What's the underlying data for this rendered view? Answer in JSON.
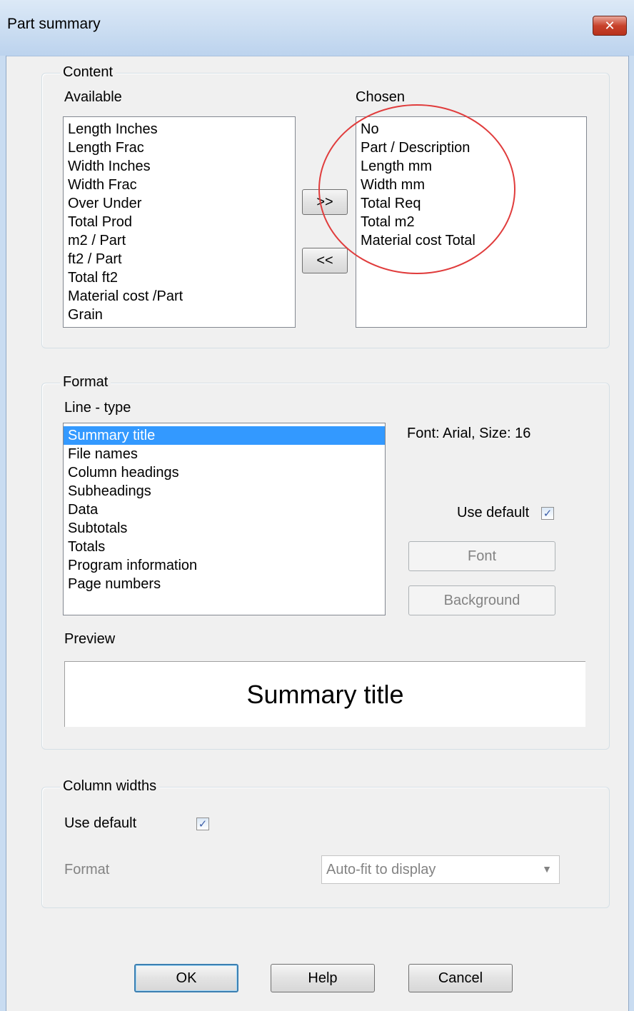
{
  "window": {
    "title": "Part summary",
    "close_icon": "close-icon"
  },
  "content": {
    "legend": "Content",
    "available_label": "Available",
    "chosen_label": "Chosen",
    "available_items": [
      "Length Inches",
      "Length Frac",
      "Width Inches",
      "Width Frac",
      "Over Under",
      "Total Prod",
      "m2 / Part",
      "ft2 / Part",
      "Total ft2",
      "Material cost /Part",
      "Grain"
    ],
    "chosen_items": [
      "No",
      "Part / Description",
      "Length mm",
      "Width mm",
      "Total Req",
      "Total m2",
      "Material cost Total"
    ],
    "add_button": ">>",
    "remove_button": "<<"
  },
  "format": {
    "legend": "Format",
    "line_type_label": "Line - type",
    "line_types": [
      "Summary title",
      "File names",
      "Column headings",
      "Subheadings",
      "Data",
      "Subtotals",
      "Totals",
      "Program information",
      "Page numbers"
    ],
    "selected_line_type": "Summary title",
    "font_info": "Font: Arial, Size: 16",
    "use_default_label": "Use default",
    "use_default_checked": true,
    "font_button": "Font",
    "background_button": "Background",
    "preview_label": "Preview",
    "preview_text": "Summary title"
  },
  "column_widths": {
    "legend": "Column widths",
    "use_default_label": "Use default",
    "use_default_checked": true,
    "format_label": "Format",
    "format_value": "Auto-fit to display"
  },
  "buttons": {
    "ok": "OK",
    "help": "Help",
    "cancel": "Cancel"
  },
  "colors": {
    "selection": "#3399ff",
    "annotation_circle": "#e03c3c"
  }
}
